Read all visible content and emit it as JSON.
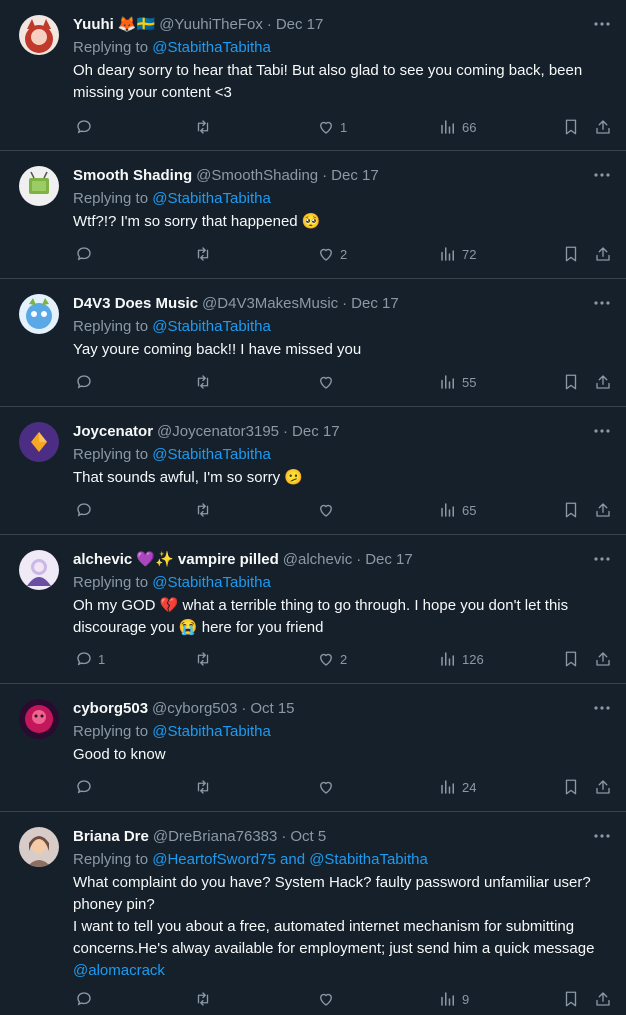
{
  "reply_prefix": "Replying to",
  "tweets": [
    {
      "name": "Yuuhi",
      "name_emoji": "🦊🇸🇪",
      "handle": "@YuuhiTheFox",
      "date": "Dec 17",
      "replying_to": "@StabithaTabitha",
      "text": "Oh deary sorry to hear that Tabi! But also glad to see you coming back, been missing your content <3",
      "replies": "",
      "retweets": "",
      "likes": "1",
      "views": "66",
      "avatar_color": "#c0392b"
    },
    {
      "name": "Smooth Shading",
      "name_emoji": "",
      "handle": "@SmoothShading",
      "date": "Dec 17",
      "replying_to": "@StabithaTabitha",
      "text": "Wtf?!? I'm so sorry that happened 🥺",
      "replies": "",
      "retweets": "",
      "likes": "2",
      "views": "72",
      "avatar_color": "#e8e8e8"
    },
    {
      "name": "D4V3 Does Music",
      "name_emoji": "",
      "handle": "@D4V3MakesMusic",
      "date": "Dec 17",
      "replying_to": "@StabithaTabitha",
      "text": "Yay youre coming back!! I have missed you",
      "replies": "",
      "retweets": "",
      "likes": "",
      "views": "55",
      "avatar_color": "#5aa9e6"
    },
    {
      "name": "Joycenator",
      "name_emoji": "",
      "handle": "@Joycenator3195",
      "date": "Dec 17",
      "replying_to": "@StabithaTabitha",
      "text": "That sounds awful, I'm so sorry 🫤",
      "replies": "",
      "retweets": "",
      "likes": "",
      "views": "65",
      "avatar_color": "#4b2e83"
    },
    {
      "name": "alchevic 💜✨ vampire pilled",
      "name_emoji": "",
      "handle": "@alchevic",
      "date": "Dec 17",
      "replying_to": "@StabithaTabitha",
      "text": "Oh my GOD 💔 what a terrible thing to go through. I hope you don't let this discourage you 😭 here for you friend",
      "replies": "1",
      "retweets": "",
      "likes": "2",
      "views": "126",
      "avatar_color": "#d9d4e8"
    },
    {
      "name": "cyborg503",
      "name_emoji": "",
      "handle": "@cyborg503",
      "date": "Oct 15",
      "replying_to": "@StabithaTabitha",
      "text": "Good to know",
      "replies": "",
      "retweets": "",
      "likes": "",
      "views": "24",
      "avatar_color": "#c2185b"
    },
    {
      "name": "Briana Dre",
      "name_emoji": "",
      "handle": "@DreBriana76383",
      "date": "Oct 5",
      "replying_to": "@HeartofSword75 and @StabithaTabitha",
      "text_main": "What complaint do you have? System Hack? faulty password unfamiliar user? phoney pin?\nI want to tell you about a free, automated internet mechanism for submitting concerns.He's alway available for employment; just send him a quick message ",
      "text_mention": "@alomacrack",
      "replies": "",
      "retweets": "",
      "likes": "",
      "views": "9",
      "avatar_color": "#8d6e63"
    }
  ]
}
